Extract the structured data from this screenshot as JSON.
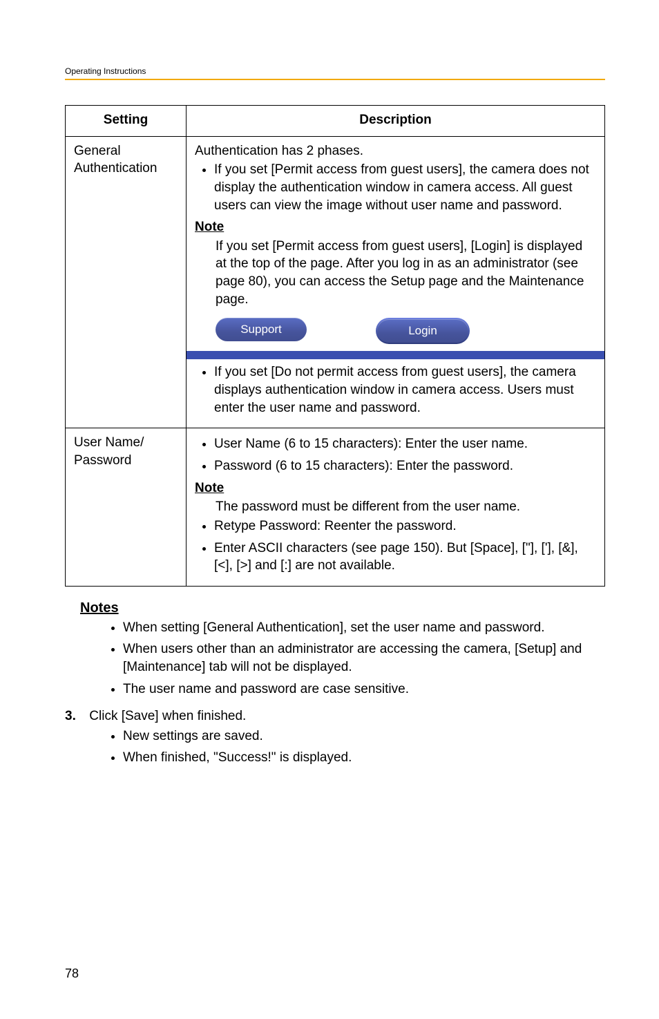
{
  "header": {
    "running_title": "Operating Instructions"
  },
  "table": {
    "headers": {
      "col1": "Setting",
      "col2": "Description"
    },
    "rows": [
      {
        "setting": "General Authentication",
        "desc_intro": "Authentication has 2 phases.",
        "bullet1": "If you set [Permit access from guest users], the camera does not display the authentication window in camera access. All guest users can view the image without user name and password.",
        "note_label": "Note",
        "note_body": "If you set [Permit access from guest users], [Login] is displayed at the top of the page. After you log in as an administrator (see page 80), you can access the Setup page and the Maintenance page.",
        "btn_support": "Support",
        "btn_login": "Login",
        "bullet2": "If you set [Do not permit access from guest users], the camera displays authentication window in camera access. Users must enter the user name and password."
      },
      {
        "setting": "User Name/\nPassword",
        "bullet_a": "User Name (6 to 15 characters): Enter the user name.",
        "bullet_b": "Password (6 to 15 characters): Enter the password.",
        "note_label": "Note",
        "note_indent": "The password must be different from the user name.",
        "bullet_c": "Retype Password: Reenter the password.",
        "bullet_d": "Enter ASCII characters (see page 150). But [Space], [\"], ['], [&], [<], [>] and [:] are not available."
      }
    ]
  },
  "notes": {
    "heading": "Notes",
    "items": [
      "When setting [General Authentication], set the user name and password.",
      "When users other than an administrator are accessing the camera, [Setup] and [Maintenance] tab will not be displayed.",
      "The user name and password are case sensitive."
    ]
  },
  "step": {
    "number": "3.",
    "text": "Click [Save] when finished.",
    "subs": [
      "New settings are saved.",
      "When finished, \"Success!\" is displayed."
    ]
  },
  "page_number": "78"
}
